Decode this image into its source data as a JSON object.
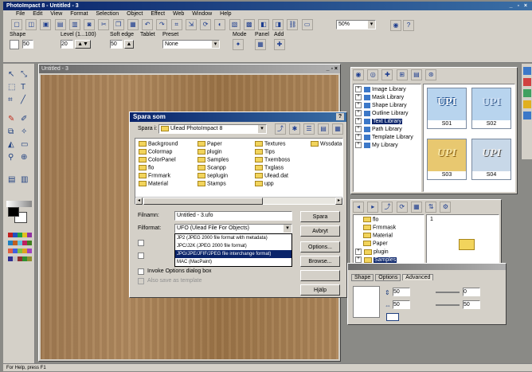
{
  "app": {
    "title": "PhotoImpact 8 - Untitled - 3"
  },
  "menu": [
    "File",
    "Edit",
    "View",
    "Format",
    "Selection",
    "Object",
    "Effect",
    "Web",
    "Window",
    "Help"
  ],
  "toolbar": {
    "zoom_value": "50%"
  },
  "attribute_bar": {
    "shape_label": "Shape",
    "level_label": "Level (1...100)",
    "soft_edge_label": "Soft edge",
    "tablet_label": "Tablet",
    "preset_label": "Preset",
    "mode_label": "Mode",
    "panel_label": "Panel",
    "add_label": "Add",
    "shape_value": "50",
    "level_value": "20",
    "soft_edge_value": "50",
    "preset_value": "None"
  },
  "doc_window": {
    "title": "Untitled - 3"
  },
  "save_dialog": {
    "title": "Spara som",
    "save_in_label": "Spara i:",
    "save_in_value": "Ulead PhotoImpact 8",
    "folders": [
      "Background",
      "Colormap",
      "ColorPanel",
      "flo",
      "Frmmark",
      "Material",
      "Paper",
      "plugin",
      "Samples",
      "Scanpp",
      "seplugin",
      "Stamps",
      "Textures",
      "Tips",
      "Txemboss",
      "Txglass",
      "Ulead.dat",
      "upp",
      "Wssdata"
    ],
    "filename_label": "Filnamn:",
    "filename_value": "Untitled - 3.ufo",
    "filetype_label": "Filformat:",
    "filetype_value": "UFO (Ulead File For Objects)",
    "filetype_options": [
      "JP2 (JPEG 2000 file format with metadata)",
      "JPC/J2K (JPEG 2000 file format)",
      "JPG/JPE/JFIF/JPEG file interchange format)",
      "MAC (MacPaint)"
    ],
    "invoke_options_label": "Invoke Options dialog box",
    "also_label": "Also save as template",
    "save_button": "Spara",
    "cancel_button": "Avbryt",
    "options_button": "Options...",
    "browse_button": "Browse...",
    "help_button": "Hjälp"
  },
  "easy_palette": {
    "libraries": [
      "Image Library",
      "Mask Library",
      "Shape Library",
      "Outline Library",
      "Text Library",
      "Path Library",
      "Template Library",
      "My Library"
    ],
    "selected_library": "Text Library",
    "thumbnails": [
      {
        "art": "UPI",
        "label": "S01"
      },
      {
        "art": "UPI",
        "label": "S02"
      },
      {
        "art": "UPI",
        "label": "S03"
      },
      {
        "art": "UPI",
        "label": "S04"
      }
    ]
  },
  "explorer_panel": {
    "folders": [
      "flo",
      "Frmmask",
      "Material",
      "Paper",
      "plugin",
      "Samples"
    ],
    "selected_folder": "Samples",
    "content_item": "1"
  },
  "brush_panel": {
    "tabs": [
      "Shape",
      "Options",
      "Advanced"
    ],
    "active_tab": "Advanced",
    "value_1": "50",
    "value_2": "50",
    "value_3": "0",
    "value_4": "50"
  },
  "statusbar": {
    "text": "For Help, press F1"
  },
  "colors": {
    "title_active": "#0a246a",
    "face": "#d4d0c8",
    "selection": "#0a246a"
  }
}
